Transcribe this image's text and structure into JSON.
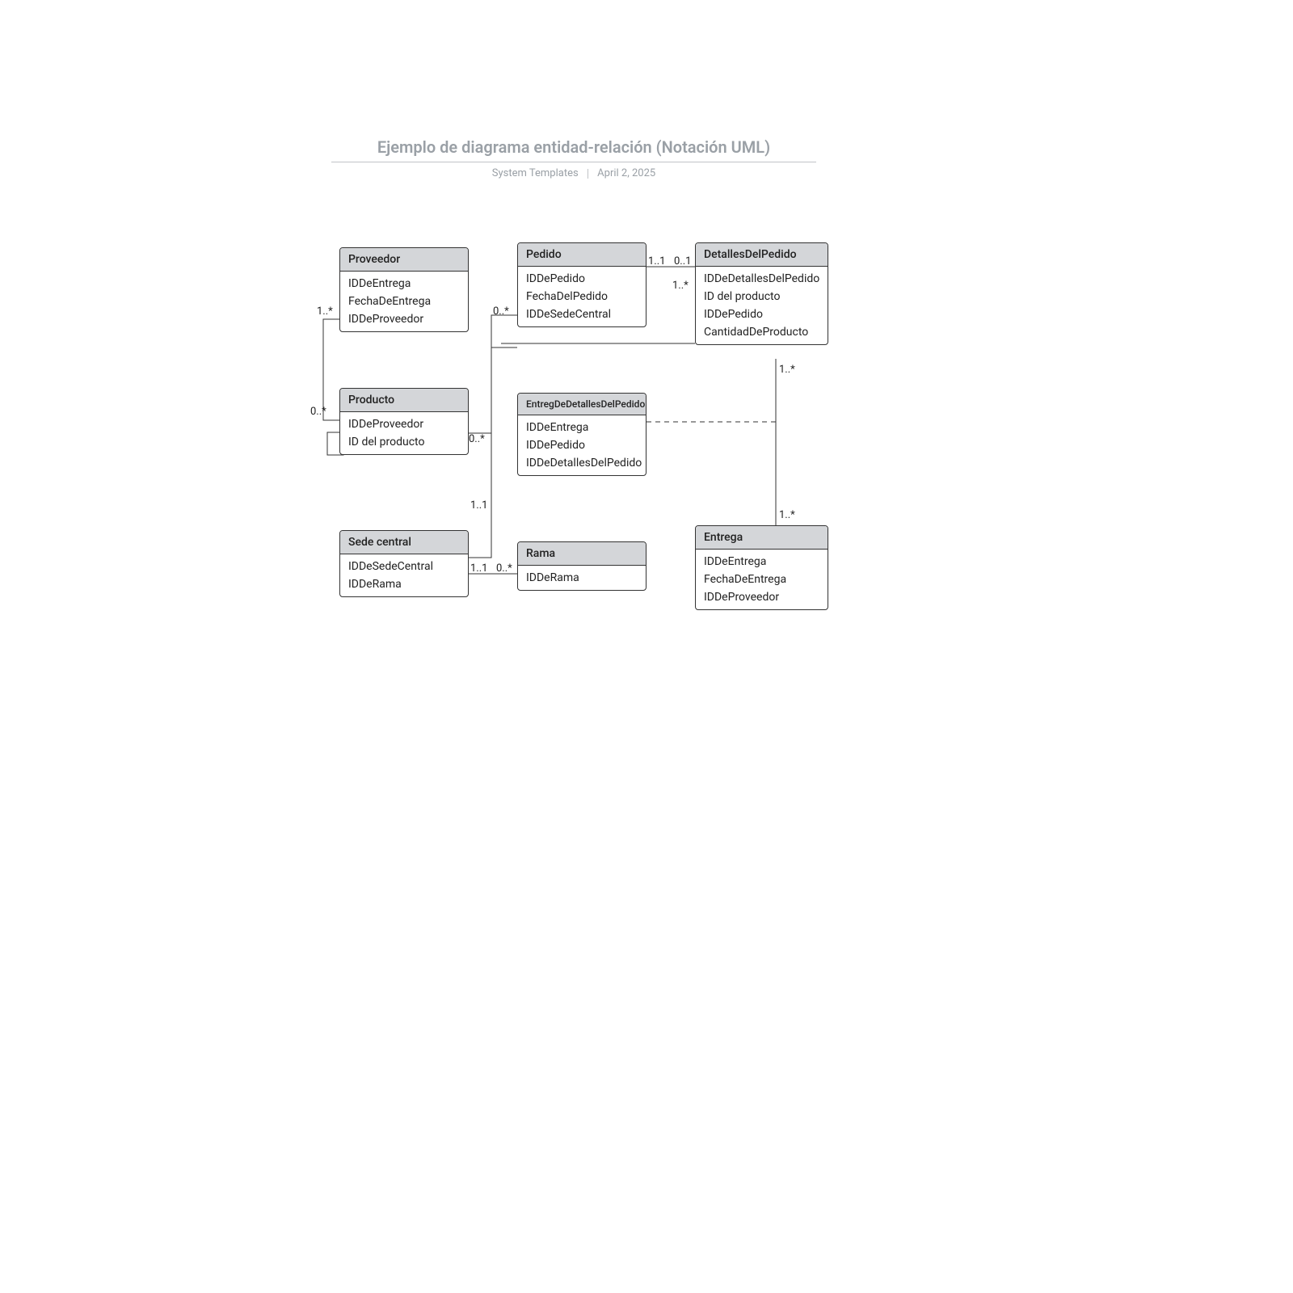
{
  "header": {
    "title": "Ejemplo de diagrama entidad-relación (Notación UML)",
    "subtitle_left": "System Templates",
    "subtitle_right": "April 2, 2025"
  },
  "entities": {
    "proveedor": {
      "title": "Proveedor",
      "attrs": [
        "IDDeEntrega",
        "FechaDeEntrega",
        "IDDeProveedor"
      ]
    },
    "pedido": {
      "title": "Pedido",
      "attrs": [
        "IDDePedido",
        "FechaDelPedido",
        "IDDeSedeCentral"
      ]
    },
    "detalles": {
      "title": "DetallesDelPedido",
      "attrs": [
        "IDDeDetallesDelPedido",
        "ID del producto",
        "IDDePedido",
        "CantidadDeProducto"
      ]
    },
    "producto": {
      "title": "Producto",
      "attrs": [
        "IDDeProveedor",
        "ID del producto"
      ]
    },
    "entregaDet": {
      "title": "EntregDeDetallesDelPedido",
      "attrs": [
        "IDDeEntrega",
        "IDDePedido",
        "IDDeDetallesDelPedido"
      ]
    },
    "sede": {
      "title": "Sede central",
      "attrs": [
        "IDDeSedeCentral",
        "IDDeRama"
      ]
    },
    "rama": {
      "title": "Rama",
      "attrs": [
        "IDDeRama"
      ]
    },
    "entrega": {
      "title": "Entrega",
      "attrs": [
        "IDDeEntrega",
        "FechaDeEntrega",
        "IDDeProveedor"
      ]
    }
  },
  "mult": {
    "prov_prod_top": "1..*",
    "prov_prod_bot": "0..*",
    "prod_pedido_prod": "0..*",
    "prod_pedido_ped": "0..*",
    "ped_det_ped": "1..1",
    "ped_det_det": "0..1",
    "det_below": "1..*",
    "sede_rama_sede": "1..1",
    "sede_rama_rama": "0..*",
    "sede_pedido": "1..1",
    "det_entrega_top": "1..*",
    "det_entrega_bot": "1..*"
  }
}
